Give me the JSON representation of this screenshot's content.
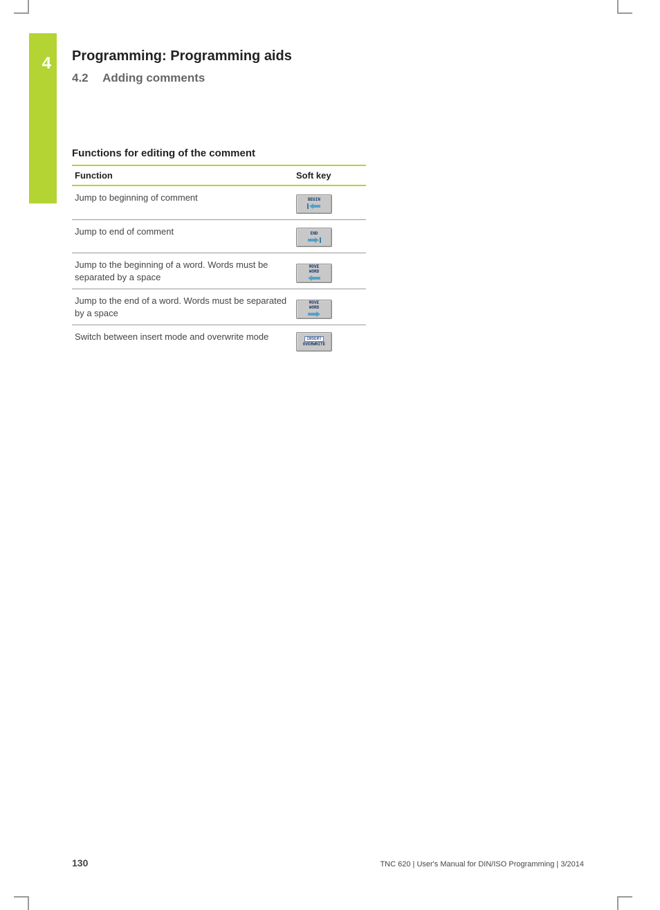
{
  "tab_number": "4",
  "chapter_title": "Programming: Programming aids",
  "section_number": "4.2",
  "section_title": "Adding comments",
  "subheading": "Functions for editing of the comment",
  "table": {
    "headers": {
      "function": "Function",
      "softkey": "Soft key"
    },
    "rows": [
      {
        "desc": "Jump to beginning of comment",
        "key_lines": [
          "BEGIN"
        ],
        "arrow": "left-stop"
      },
      {
        "desc": "Jump to end of comment",
        "key_lines": [
          "END"
        ],
        "arrow": "right-stop"
      },
      {
        "desc": "Jump to the beginning of a word. Words must be separated by a space",
        "key_lines": [
          "MOVE",
          "WORD"
        ],
        "arrow": "left"
      },
      {
        "desc": "Jump to the end of a word. Words must be separated by a space",
        "key_lines": [
          "MOVE",
          "WORD"
        ],
        "arrow": "right"
      },
      {
        "desc": "Switch between insert mode and overwrite mode",
        "key_lines": [
          "INSERT",
          "OVERWRITE"
        ],
        "arrow": "none"
      }
    ]
  },
  "footer": {
    "page": "130",
    "text": "TNC 620 | User's Manual for DIN/ISO Programming | 3/2014"
  }
}
